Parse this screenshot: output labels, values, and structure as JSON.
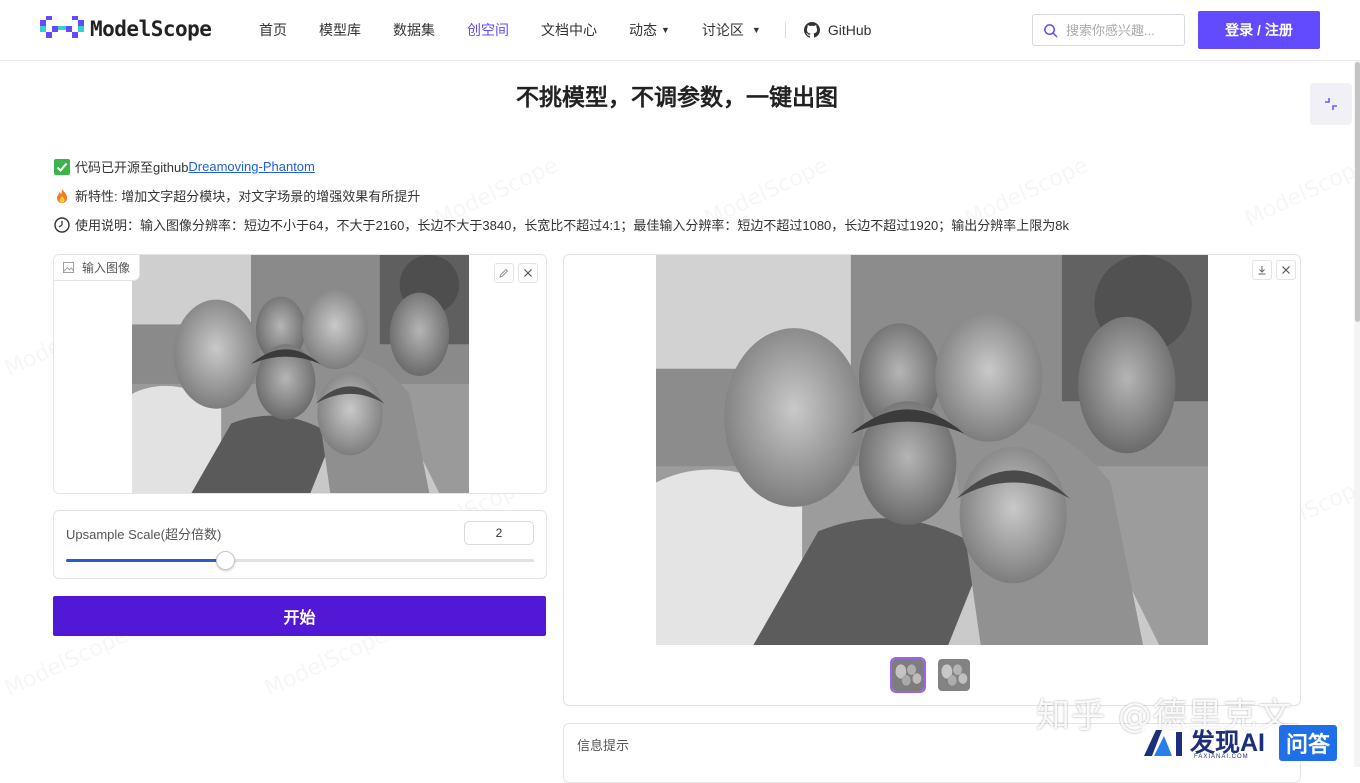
{
  "header": {
    "logo_text": "ModelScope",
    "nav": [
      {
        "label": "首页"
      },
      {
        "label": "模型库"
      },
      {
        "label": "数据集"
      },
      {
        "label": "创空间"
      },
      {
        "label": "文档中心"
      },
      {
        "label": "动态"
      },
      {
        "label": "讨论区"
      },
      {
        "label": "GitHub"
      }
    ],
    "active_nav": "创空间",
    "search_placeholder": "搜索你感兴趣...",
    "login_label": "登录 / 注册",
    "accent_color": "#624aff"
  },
  "page": {
    "title": "不挑模型，不调参数，一键出图",
    "notes": [
      {
        "icon": "checkmark-icon",
        "text": "代码已开源至github ",
        "link": "Dreamoving-Phantom"
      },
      {
        "icon": "fire-icon",
        "text": "新特性: 增加文字超分模块，对文字场景的增强效果有所提升"
      },
      {
        "icon": "clock-icon",
        "text": "使用说明：输入图像分辨率：短边不小于64，不大于2160，长边不大于3840，长宽比不超过4:1；最佳输入分辨率：短边不超过1080，长边不超过1920；输出分辨率上限为8k"
      }
    ]
  },
  "input_panel": {
    "label": "输入图像"
  },
  "slider": {
    "label": "Upsample Scale(超分倍数)",
    "value": "2",
    "min": 1,
    "max": 5,
    "fraction": 0.34
  },
  "start_button": {
    "label": "开始",
    "color": "#5118d6"
  },
  "output_panel": {
    "thumbnail_count": 2,
    "selected_thumbnail": 0
  },
  "info_panel": {
    "label": "信息提示"
  },
  "watermark": {
    "text": "ModelScope",
    "zhihu": "知乎 @德里克文",
    "badge_main": "发现AI",
    "badge_sub": "FAXIANAI.COM",
    "badge_qa": "问答"
  }
}
